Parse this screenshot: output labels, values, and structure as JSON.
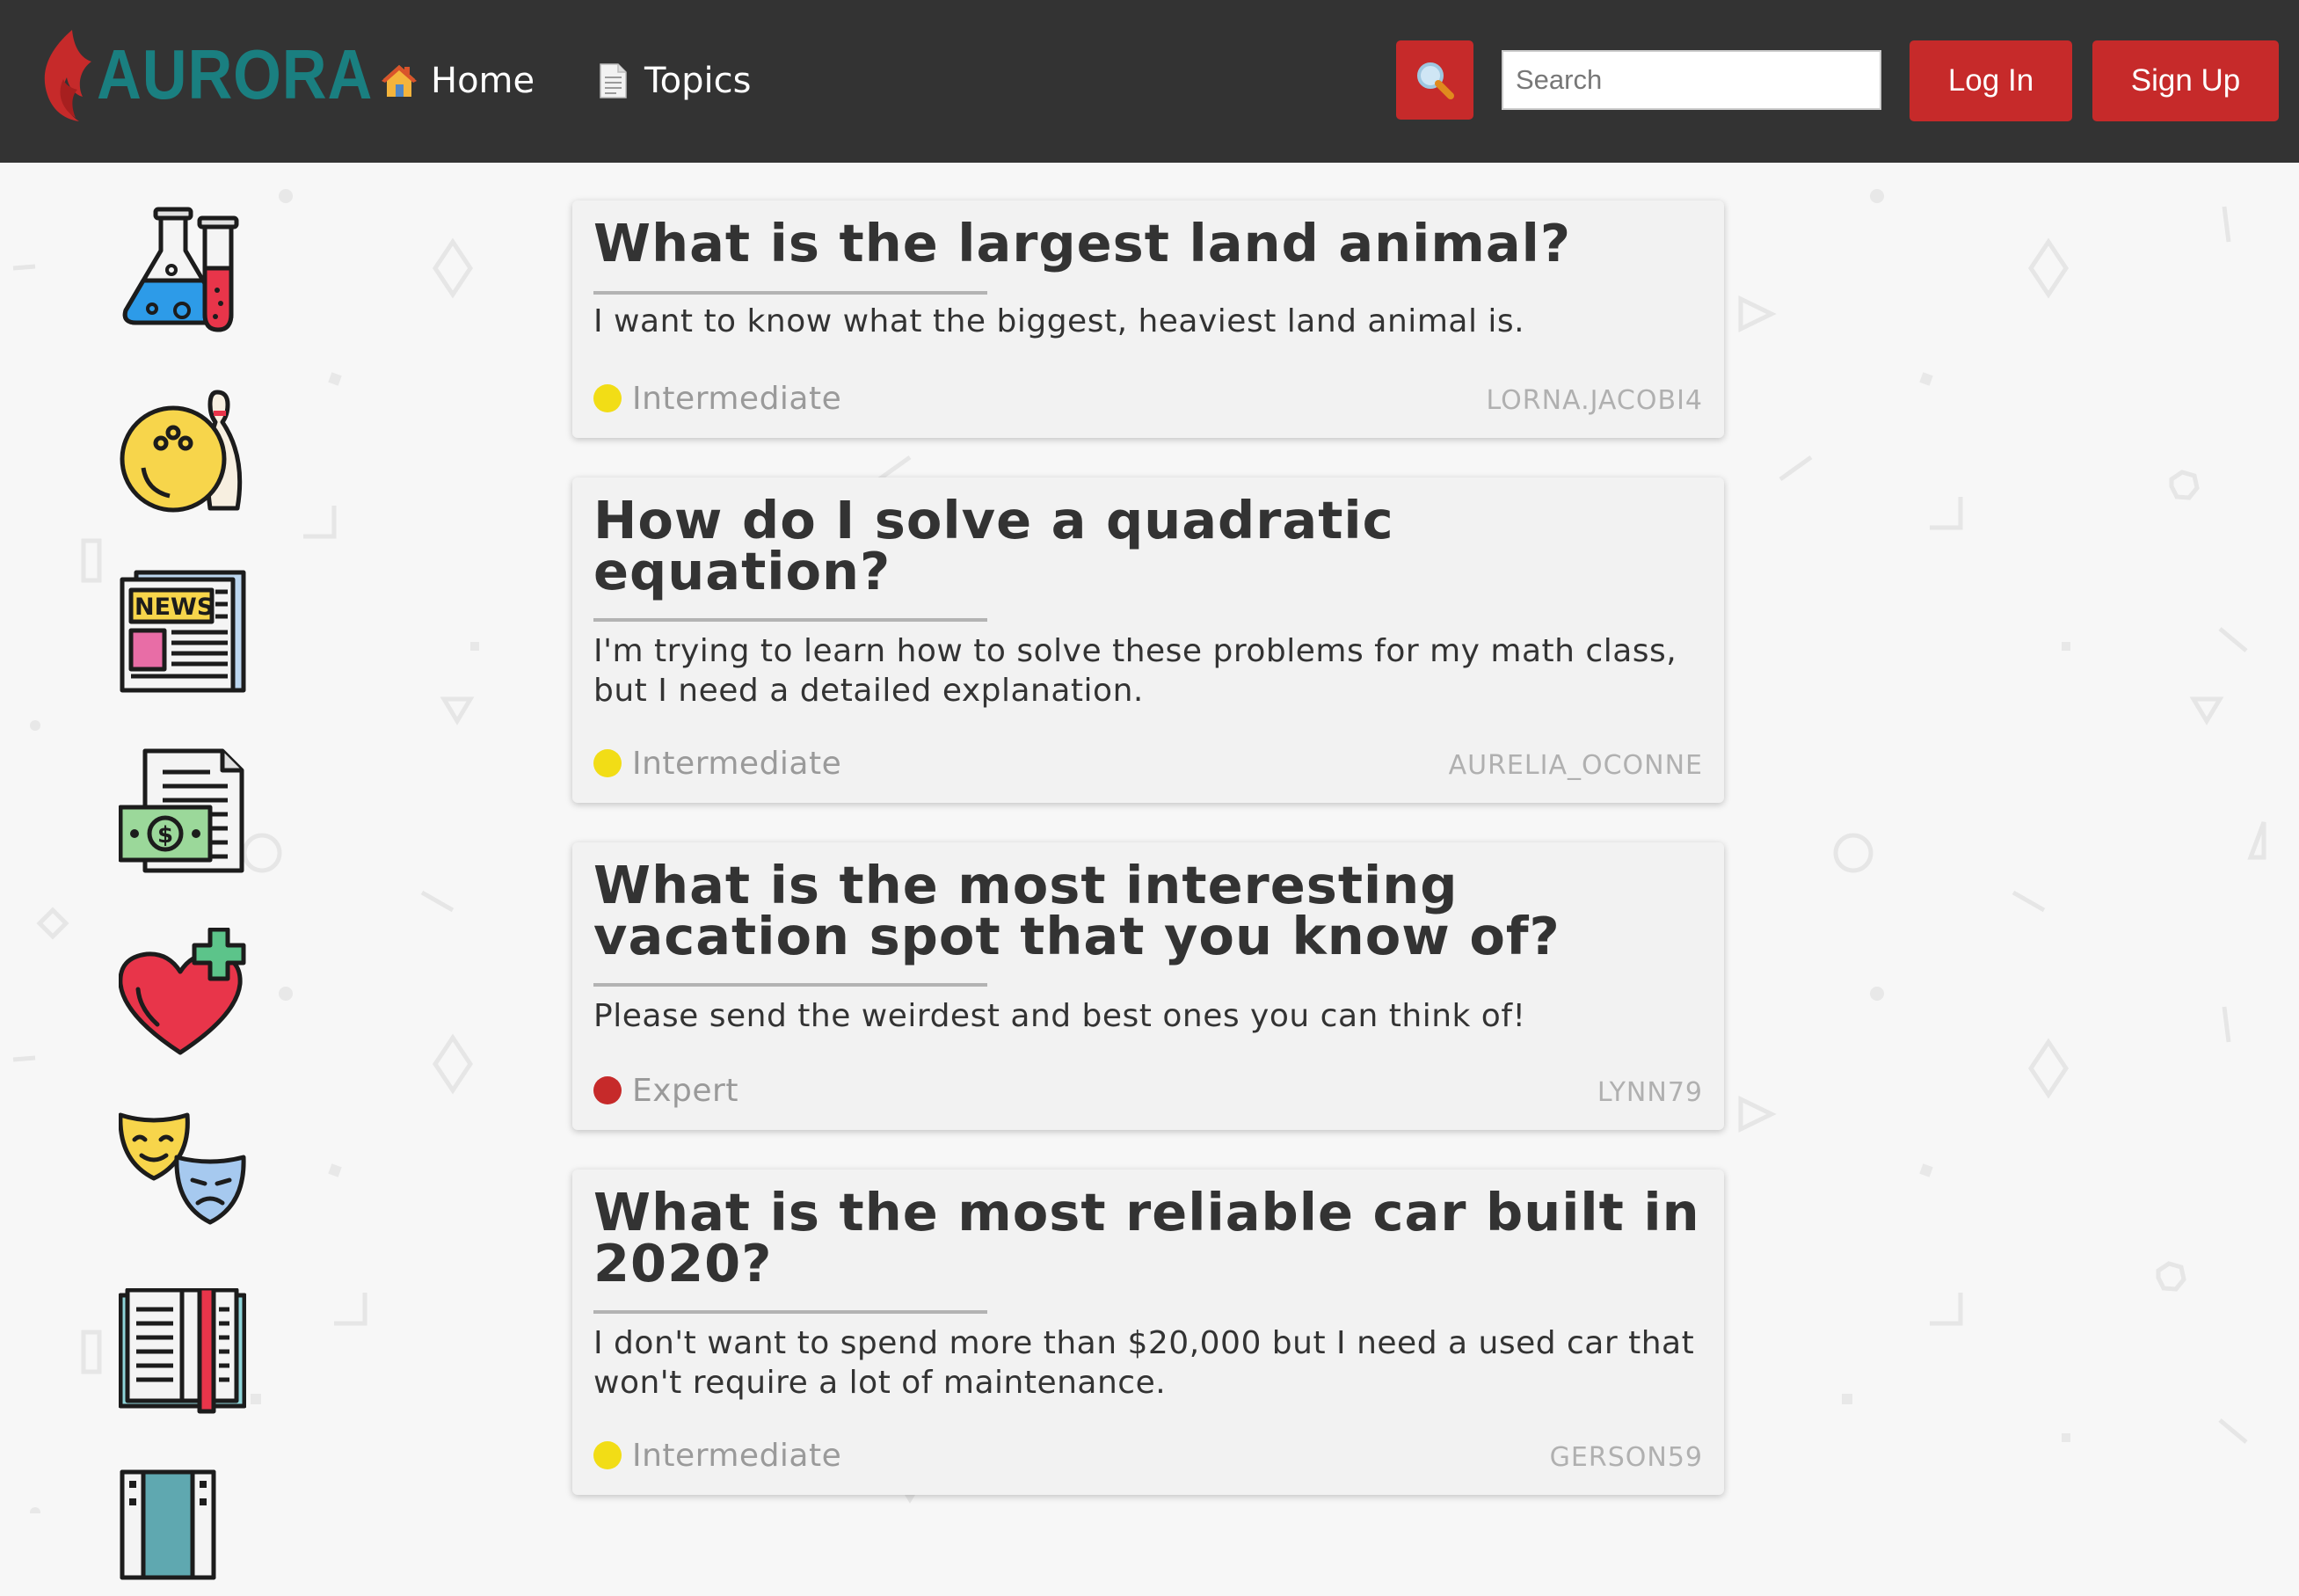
{
  "brand": {
    "name": "AURORA",
    "color": "#1a7f80",
    "flame_color": "#c62a2a"
  },
  "nav": {
    "home": {
      "label": "Home",
      "icon": "house-icon"
    },
    "topics": {
      "label": "Topics",
      "icon": "page-icon"
    }
  },
  "search": {
    "button_icon": "magnifier-icon",
    "placeholder": "Search",
    "value": ""
  },
  "auth": {
    "login_label": "Log In",
    "signup_label": "Sign Up"
  },
  "colors": {
    "header_bg": "#333333",
    "accent": "#c62a2a",
    "intermediate": "#f2dd16",
    "expert": "#c62a2a"
  },
  "sidebar_topics": [
    {
      "icon": "science-flask-icon"
    },
    {
      "icon": "bowling-icon"
    },
    {
      "icon": "newspaper-icon"
    },
    {
      "icon": "money-document-icon"
    },
    {
      "icon": "health-heart-icon"
    },
    {
      "icon": "theater-masks-icon"
    },
    {
      "icon": "book-icon"
    },
    {
      "icon": "film-icon"
    }
  ],
  "questions": [
    {
      "title": "What is the largest land animal?",
      "description": "I want to know what the biggest, heaviest land animal is.",
      "level": "Intermediate",
      "level_color": "#f2dd16",
      "author": "LORNA.JACOBI4"
    },
    {
      "title": "How do I solve a quadratic equation?",
      "description": "I'm trying to learn how to solve these problems for my math class, but I need a detailed explanation.",
      "level": "Intermediate",
      "level_color": "#f2dd16",
      "author": "AURELIA_OCONNE"
    },
    {
      "title": "What is the most interesting vacation spot that you know of?",
      "description": "Please send the weirdest and best ones you can think of!",
      "level": "Expert",
      "level_color": "#c62a2a",
      "author": "LYNN79"
    },
    {
      "title": "What is the most reliable car built in 2020?",
      "description": "I don't want to spend more than $20,000 but I need a used car that won't require a lot of maintenance.",
      "level": "Intermediate",
      "level_color": "#f2dd16",
      "author": "GERSON59"
    }
  ]
}
